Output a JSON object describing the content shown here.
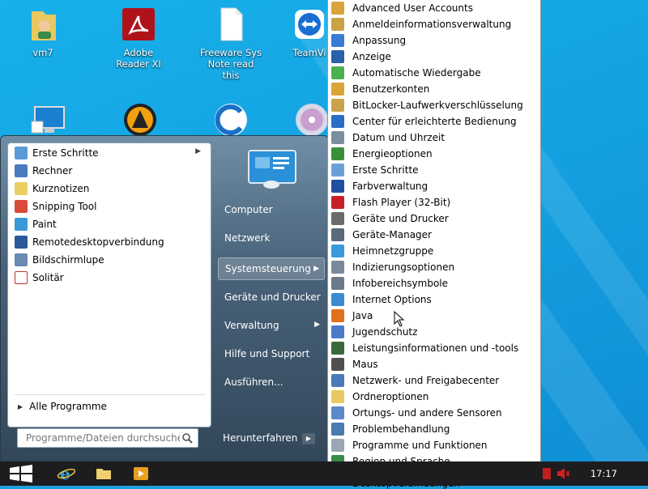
{
  "desktop": {
    "icons": [
      {
        "label": "vm7",
        "icon": "user-folder-icon"
      },
      {
        "label": "Adobe Reader XI",
        "icon": "adobe-reader-icon"
      },
      {
        "label": "Freeware Sys Note read this",
        "icon": "text-document-icon"
      },
      {
        "label": "TeamVi",
        "icon": "teamviewer-icon"
      },
      {
        "label": "",
        "icon": "computer-icon"
      },
      {
        "label": "",
        "icon": "aimp-icon"
      },
      {
        "label": "",
        "icon": "ccleaner-icon"
      },
      {
        "label": "",
        "icon": "dvd-icon"
      }
    ]
  },
  "start_menu": {
    "programs": [
      {
        "label": "Erste Schritte",
        "icon": "getting-started-icon",
        "has_submenu": true
      },
      {
        "label": "Rechner",
        "icon": "calculator-icon"
      },
      {
        "label": "Kurznotizen",
        "icon": "sticky-notes-icon"
      },
      {
        "label": "Snipping Tool",
        "icon": "snipping-tool-icon"
      },
      {
        "label": "Paint",
        "icon": "paint-icon"
      },
      {
        "label": "Remotedesktopverbindung",
        "icon": "remote-desktop-icon"
      },
      {
        "label": "Bildschirmlupe",
        "icon": "magnifier-icon"
      },
      {
        "label": "Solitär",
        "icon": "solitaire-icon"
      }
    ],
    "all_programs": "Alle Programme",
    "search_placeholder": "Programme/Dateien durchsuchen",
    "right_items": [
      {
        "label": "Computer"
      },
      {
        "label": "Netzwerk"
      },
      {
        "label": "Systemsteuerung",
        "has_submenu": true,
        "highlighted": true
      },
      {
        "label": "Geräte und Drucker"
      },
      {
        "label": "Verwaltung",
        "has_submenu": true
      },
      {
        "label": "Hilfe und Support"
      },
      {
        "label": "Ausführen..."
      }
    ],
    "shutdown_label": "Herunterfahren"
  },
  "control_panel_menu": {
    "items": [
      {
        "label": "Advanced User Accounts",
        "icon": "users-icon",
        "color": "#d9a43a"
      },
      {
        "label": "Anmeldeinformationsverwaltung",
        "icon": "credential-manager-icon",
        "color": "#c9a24a"
      },
      {
        "label": "Anpassung",
        "icon": "personalization-icon",
        "color": "#3a7bd5"
      },
      {
        "label": "Anzeige",
        "icon": "display-icon",
        "color": "#2b5fa8"
      },
      {
        "label": "Automatische Wiedergabe",
        "icon": "autoplay-icon",
        "color": "#4caf50"
      },
      {
        "label": "Benutzerkonten",
        "icon": "user-accounts-icon",
        "color": "#d9a43a"
      },
      {
        "label": "BitLocker-Laufwerkverschlüsselung",
        "icon": "bitlocker-icon",
        "color": "#c9a24a"
      },
      {
        "label": "Center für erleichterte Bedienung",
        "icon": "ease-of-access-icon",
        "color": "#2b6cc4"
      },
      {
        "label": "Datum und Uhrzeit",
        "icon": "clock-icon",
        "color": "#7a8ea0"
      },
      {
        "label": "Energieoptionen",
        "icon": "power-options-icon",
        "color": "#3b8f3b"
      },
      {
        "label": "Erste Schritte",
        "icon": "getting-started-icon",
        "color": "#6aa0d8"
      },
      {
        "label": "Farbverwaltung",
        "icon": "color-management-icon",
        "color": "#1f4fa0"
      },
      {
        "label": "Flash Player (32-Bit)",
        "icon": "flash-player-icon",
        "color": "#c8202a"
      },
      {
        "label": "Geräte und Drucker",
        "icon": "printer-icon",
        "color": "#6b6b6b"
      },
      {
        "label": "Geräte-Manager",
        "icon": "device-manager-icon",
        "color": "#5a6a7a"
      },
      {
        "label": "Heimnetzgruppe",
        "icon": "homegroup-icon",
        "color": "#3a9ad9"
      },
      {
        "label": "Indizierungsoptionen",
        "icon": "indexing-icon",
        "color": "#7a8a9a"
      },
      {
        "label": "Infobereichsymbole",
        "icon": "notification-area-icon",
        "color": "#6a7a8a"
      },
      {
        "label": "Internet Options",
        "icon": "internet-options-icon",
        "color": "#3a8ad0"
      },
      {
        "label": "Java",
        "icon": "java-icon",
        "color": "#e07020"
      },
      {
        "label": "Jugendschutz",
        "icon": "parental-controls-icon",
        "color": "#4a7ac8"
      },
      {
        "label": "Leistungsinformationen und -tools",
        "icon": "performance-icon",
        "color": "#3a6a3a"
      },
      {
        "label": "Maus",
        "icon": "mouse-icon",
        "color": "#505050"
      },
      {
        "label": "Netzwerk- und Freigabecenter",
        "icon": "network-center-icon",
        "color": "#4a7ab8"
      },
      {
        "label": "Ordneroptionen",
        "icon": "folder-options-icon",
        "color": "#e8c860"
      },
      {
        "label": "Ortungs- und andere Sensoren",
        "icon": "sensors-icon",
        "color": "#5a8ac8"
      },
      {
        "label": "Problembehandlung",
        "icon": "troubleshooting-icon",
        "color": "#4a7ab0"
      },
      {
        "label": "Programme und Funktionen",
        "icon": "programs-features-icon",
        "color": "#9aa6b2"
      },
      {
        "label": "Region und Sprache",
        "icon": "region-language-icon",
        "color": "#3a8a4a"
      },
      {
        "label": "Remote-Anwendungs- und Desktopverbindungen",
        "icon": "remoteapp-icon",
        "color": "#4a6ab0"
      }
    ]
  },
  "taskbar": {
    "start": "windows-start-icon",
    "pinned": [
      "internet-explorer-icon",
      "file-explorer-icon",
      "media-player-icon"
    ],
    "clock": "17:17"
  }
}
